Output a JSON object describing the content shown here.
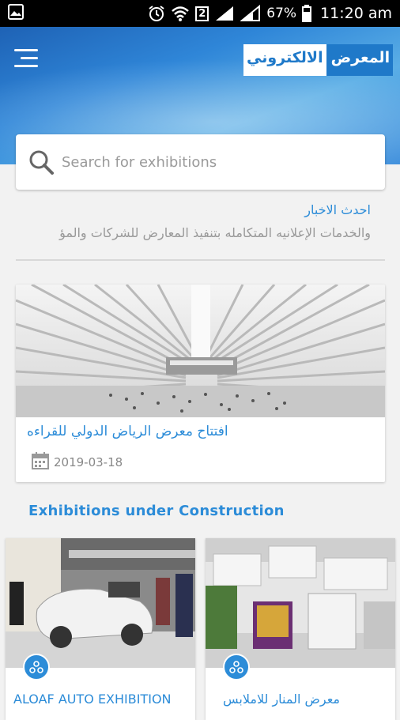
{
  "status_bar": {
    "battery": "67%",
    "sim": "2",
    "time": "11:20 am"
  },
  "header": {
    "logo_part1": "المعرض",
    "logo_part2": "الالكتروني"
  },
  "search": {
    "placeholder": "Search for exhibitions"
  },
  "news": {
    "title": "احدث الاخبار",
    "ticker": "والخدمات الإعلانيه المتكامله بتنفيذ المعارض للشركات والمؤ"
  },
  "featured_news": {
    "title": "افتتاح معرض الرياض الدولي للقراءه",
    "date": "2019-03-18"
  },
  "section": {
    "title": "Exhibitions under Construction"
  },
  "exhibitions": [
    {
      "name": "ALOAF AUTO EXHIBITION"
    },
    {
      "name": "معرض المنار للاملابس"
    }
  ],
  "colors": {
    "accent": "#2c8cd8",
    "header_blue": "#1f79c9"
  }
}
